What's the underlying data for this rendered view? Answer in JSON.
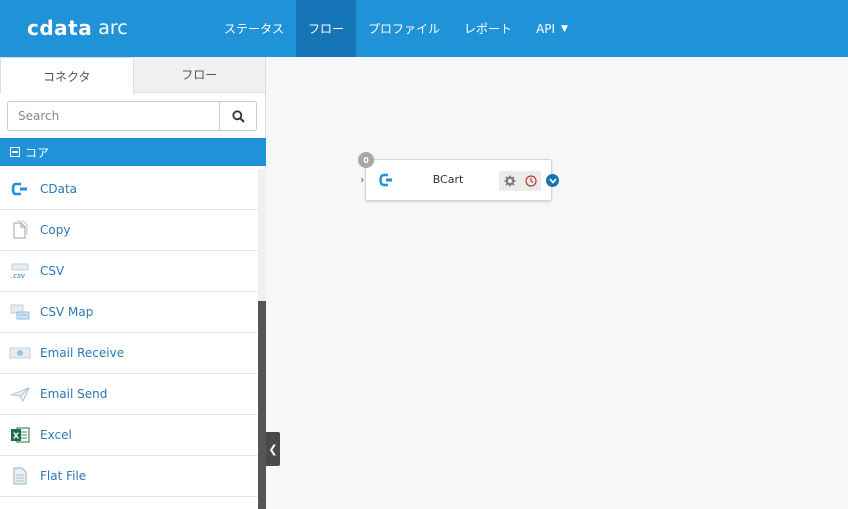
{
  "app": {
    "brand": "cdata",
    "product": "arc"
  },
  "nav": [
    {
      "label": "ステータス",
      "active": false
    },
    {
      "label": "フロー",
      "active": true
    },
    {
      "label": "プロファイル",
      "active": false
    },
    {
      "label": "レポート",
      "active": false
    },
    {
      "label": "API",
      "active": false,
      "dropdown": true
    }
  ],
  "sidebar": {
    "tabs": [
      {
        "label": "コネクタ",
        "active": true
      },
      {
        "label": "フロー",
        "active": false
      }
    ],
    "search": {
      "placeholder": "Search",
      "value": ""
    },
    "section": {
      "label": "コア"
    },
    "items": [
      {
        "label": "CData",
        "icon": "cdata-icon"
      },
      {
        "label": "Copy",
        "icon": "copy-icon"
      },
      {
        "label": "CSV",
        "icon": "csv-icon"
      },
      {
        "label": "CSV Map",
        "icon": "csv-map-icon"
      },
      {
        "label": "Email Receive",
        "icon": "email-receive-icon"
      },
      {
        "label": "Email Send",
        "icon": "email-send-icon"
      },
      {
        "label": "Excel",
        "icon": "excel-icon"
      },
      {
        "label": "Flat File",
        "icon": "flat-file-icon"
      }
    ]
  },
  "canvas": {
    "node": {
      "label": "BCart",
      "count": "0",
      "icon": "cdata-icon"
    }
  },
  "colors": {
    "header": "#2092d8",
    "nav_active": "#1675b6",
    "link": "#2b78b4",
    "section": "#2092d8"
  }
}
